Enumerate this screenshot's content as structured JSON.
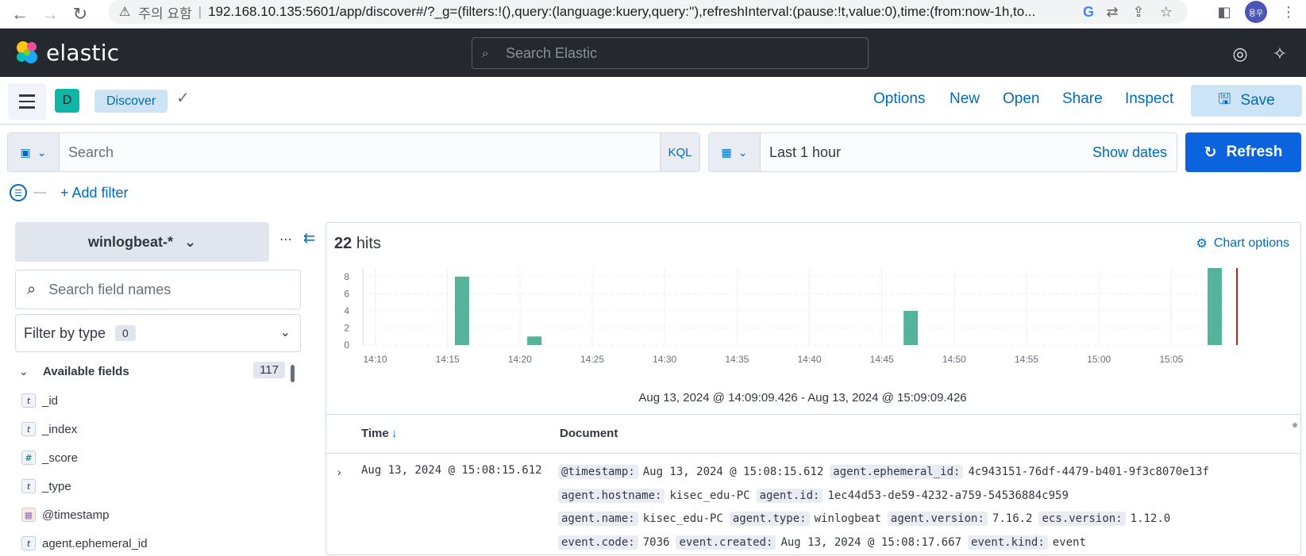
{
  "browser": {
    "security_warning": "주의 요함",
    "url": "192.168.10.135:5601/app/discover#/?_g=(filters:!(),query:(language:kuery,query:''),refreshInterval:(pause:!t,value:0),time:(from:now-1h,to...",
    "profile_initials": "용우"
  },
  "header": {
    "brand": "elastic",
    "search_placeholder": "Search Elastic"
  },
  "appbar": {
    "space_initial": "D",
    "breadcrumb": "Discover",
    "links": [
      "Options",
      "New",
      "Open",
      "Share",
      "Inspect"
    ],
    "save_label": "Save"
  },
  "query": {
    "placeholder": "Search",
    "language": "KQL",
    "time_range": "Last 1 hour",
    "show_dates": "Show dates",
    "refresh_label": "Refresh",
    "add_filter": "+ Add filter"
  },
  "sidebar": {
    "index_pattern": "winlogbeat-*",
    "field_search_placeholder": "Search field names",
    "filter_by_type": "Filter by type",
    "filter_count": "0",
    "available_label": "Available fields",
    "available_count": "117",
    "fields": [
      {
        "type": "t",
        "name": "_id"
      },
      {
        "type": "t",
        "name": "_index"
      },
      {
        "type": "#",
        "name": "_score"
      },
      {
        "type": "t",
        "name": "_type"
      },
      {
        "type": "date",
        "name": "@timestamp"
      },
      {
        "type": "t",
        "name": "agent.ephemeral_id"
      }
    ]
  },
  "results": {
    "hits_count": "22",
    "hits_label": "hits",
    "chart_options": "Chart options",
    "range_text": "Aug 13, 2024 @ 14:09:09.426 - Aug 13, 2024 @ 15:09:09.426",
    "col_time": "Time",
    "col_document": "Document",
    "row_time": "Aug 13, 2024 @ 15:08:15.612",
    "row_doc": [
      [
        [
          "@timestamp:",
          "Aug 13, 2024 @ 15:08:15.612"
        ],
        [
          "agent.ephemeral_id:",
          "4c943151-76df-4479-b401-9f3c8070e13f"
        ]
      ],
      [
        [
          "agent.hostname:",
          "kisec_edu-PC"
        ],
        [
          "agent.id:",
          "1ec44d53-de59-4232-a759-54536884c959"
        ]
      ],
      [
        [
          "agent.name:",
          "kisec_edu-PC"
        ],
        [
          "agent.type:",
          "winlogbeat"
        ],
        [
          "agent.version:",
          "7.16.2"
        ],
        [
          "ecs.version:",
          "1.12.0"
        ]
      ],
      [
        [
          "event.code:",
          "7036"
        ],
        [
          "event.created:",
          "Aug 13, 2024 @ 15:08:17.667"
        ],
        [
          "event.kind:",
          "event"
        ]
      ]
    ]
  },
  "colors": {
    "bar": "#54b399",
    "accent": "#006bb8",
    "refresh_bg": "#0b64dd",
    "now_marker": "#bd271e"
  },
  "chart_data": {
    "type": "bar",
    "x_ticks": [
      "14:10",
      "14:15",
      "14:20",
      "14:25",
      "14:30",
      "14:35",
      "14:40",
      "14:45",
      "14:50",
      "14:55",
      "15:00",
      "15:05"
    ],
    "y_ticks": [
      0,
      2,
      4,
      6,
      8
    ],
    "ylim": [
      0,
      9
    ],
    "xlim_minutes": [
      0,
      60
    ],
    "bars": [
      {
        "time": "14:16",
        "value": 8
      },
      {
        "time": "14:21",
        "value": 1
      },
      {
        "time": "14:47",
        "value": 4
      },
      {
        "time": "15:08",
        "value": 9
      }
    ],
    "grid": true,
    "legend": "none"
  }
}
